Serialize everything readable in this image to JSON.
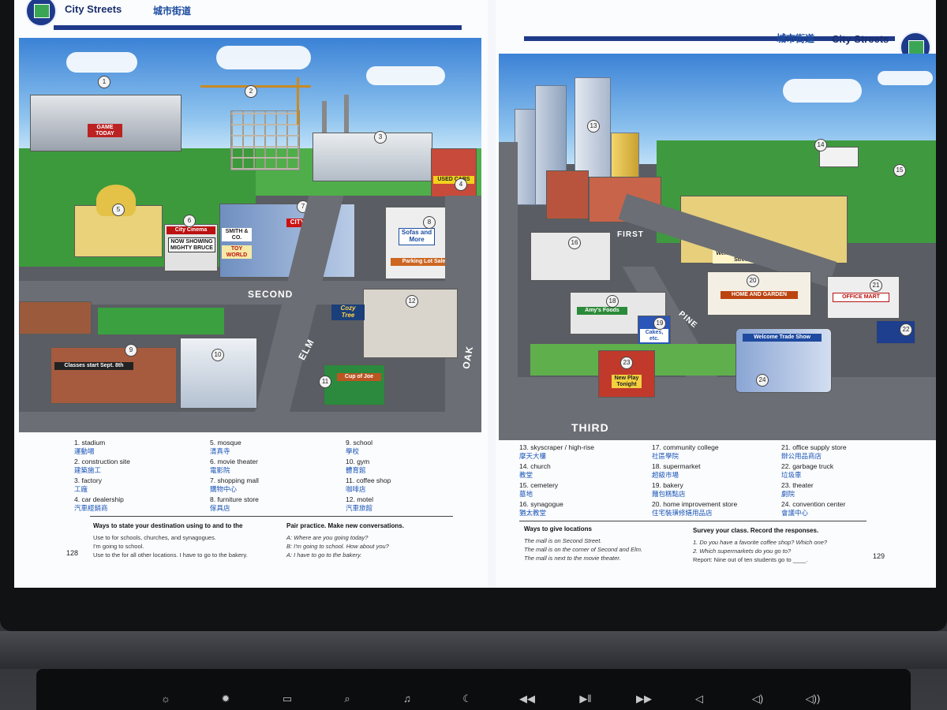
{
  "left_page": {
    "header_title": "City Streets",
    "header_cn": "城市街道",
    "page_number": "128",
    "streets": [
      "SECOND",
      "ELM",
      "OAK"
    ],
    "signs": {
      "game_today": "GAME TODAY",
      "used_cars": "USED CARS",
      "city_cinema": "City Cinema",
      "now_showing": "NOW SHOWING MIGHTY BRUCE",
      "city_mall": "CITY MALL",
      "smith": "SMITH & CO.",
      "toy_world": "TOY WORLD",
      "sofas": "Sofas and More",
      "parking_lot_sale": "Parking Lot Sale",
      "cozy_tree": "Cozy Tree",
      "cup_of_joe": "Cup of Joe",
      "classes_start": "Classes start Sept. 8th"
    },
    "vocab": [
      {
        "n": "1.",
        "en": "stadium",
        "cn": "運動場"
      },
      {
        "n": "2.",
        "en": "construction site",
        "cn": "建築施工"
      },
      {
        "n": "3.",
        "en": "factory",
        "cn": "工廠"
      },
      {
        "n": "4.",
        "en": "car dealership",
        "cn": "汽車經銷商"
      },
      {
        "n": "5.",
        "en": "mosque",
        "cn": "清真寺"
      },
      {
        "n": "6.",
        "en": "movie theater",
        "cn": "電影院"
      },
      {
        "n": "7.",
        "en": "shopping mall",
        "cn": "購物中心"
      },
      {
        "n": "8.",
        "en": "furniture store",
        "cn": "傢具店"
      },
      {
        "n": "9.",
        "en": "school",
        "cn": "學校"
      },
      {
        "n": "10.",
        "en": "gym",
        "cn": "體育館"
      },
      {
        "n": "11.",
        "en": "coffee shop",
        "cn": "咖啡店"
      },
      {
        "n": "12.",
        "en": "motel",
        "cn": "汽車旅館"
      }
    ],
    "tips": {
      "ways_title": "Ways to state your destination using to and to the",
      "ways_lines": [
        "Use to for schools, churches, and synagogues.",
        "I'm going to school.",
        "Use to the for all other locations. I have to go to the bakery."
      ],
      "pair_title": "Pair practice. Make new conversations.",
      "pair_lines": [
        "A: Where are you going today?",
        "B: I'm going to school. How about you?",
        "A: I have to go to the bakery."
      ]
    }
  },
  "right_page": {
    "header_title": "City Streets",
    "header_cn": "城市街道",
    "page_number": "129",
    "streets": [
      "FIRST",
      "PINE",
      "THIRD"
    ],
    "signs": {
      "welcome_central": "Welcome to Central Street",
      "home_garden": "HOME AND GARDEN",
      "office_mart": "OFFICE MART",
      "amys_foods": "Amy's Foods",
      "cakes": "Cakes, etc.",
      "welcome_trade": "Welcome Trade Show",
      "new_play": "New Play Tonight"
    },
    "vocab": [
      {
        "n": "13.",
        "en": "skyscraper / high-rise",
        "cn": "摩天大樓"
      },
      {
        "n": "14.",
        "en": "church",
        "cn": "教堂"
      },
      {
        "n": "15.",
        "en": "cemetery",
        "cn": "墓地"
      },
      {
        "n": "16.",
        "en": "synagogue",
        "cn": "猶太教堂"
      },
      {
        "n": "17.",
        "en": "community college",
        "cn": "社區學院"
      },
      {
        "n": "18.",
        "en": "supermarket",
        "cn": "超級市場"
      },
      {
        "n": "19.",
        "en": "bakery",
        "cn": "麵包糕點店"
      },
      {
        "n": "20.",
        "en": "home improvement store",
        "cn": "住宅裝璜修繕用品店"
      },
      {
        "n": "21.",
        "en": "office supply store",
        "cn": "辦公用品商店"
      },
      {
        "n": "22.",
        "en": "garbage truck",
        "cn": "垃圾車"
      },
      {
        "n": "23.",
        "en": "theater",
        "cn": "劇院"
      },
      {
        "n": "24.",
        "en": "convention center",
        "cn": "會議中心"
      }
    ],
    "tips": {
      "ways_title": "Ways to give locations",
      "ways_lines": [
        "The mall is on Second Street.",
        "The mall is on the corner of Second and Elm.",
        "The mall is next to the movie theater."
      ],
      "survey_title": "Survey your class. Record the responses.",
      "survey_lines": [
        "1. Do you have a favorite coffee shop? Which one?",
        "2. Which supermarkets do you go to?",
        "Report: Nine out of ten students go to ____."
      ]
    }
  },
  "keyboard_icons": [
    "brightness-down-icon",
    "brightness-up-icon",
    "mission-control-icon",
    "search-icon",
    "dictation-icon",
    "do-not-disturb-icon",
    "rewind-icon",
    "play-pause-icon",
    "fast-forward-icon",
    "mute-icon",
    "volume-down-icon",
    "volume-up-icon"
  ],
  "keyboard_glyphs": [
    "☼",
    "✹",
    "▭",
    "⌕",
    "♫",
    "☾",
    "◀◀",
    "▶‖",
    "▶▶",
    "◁",
    "◁)",
    "◁))"
  ]
}
